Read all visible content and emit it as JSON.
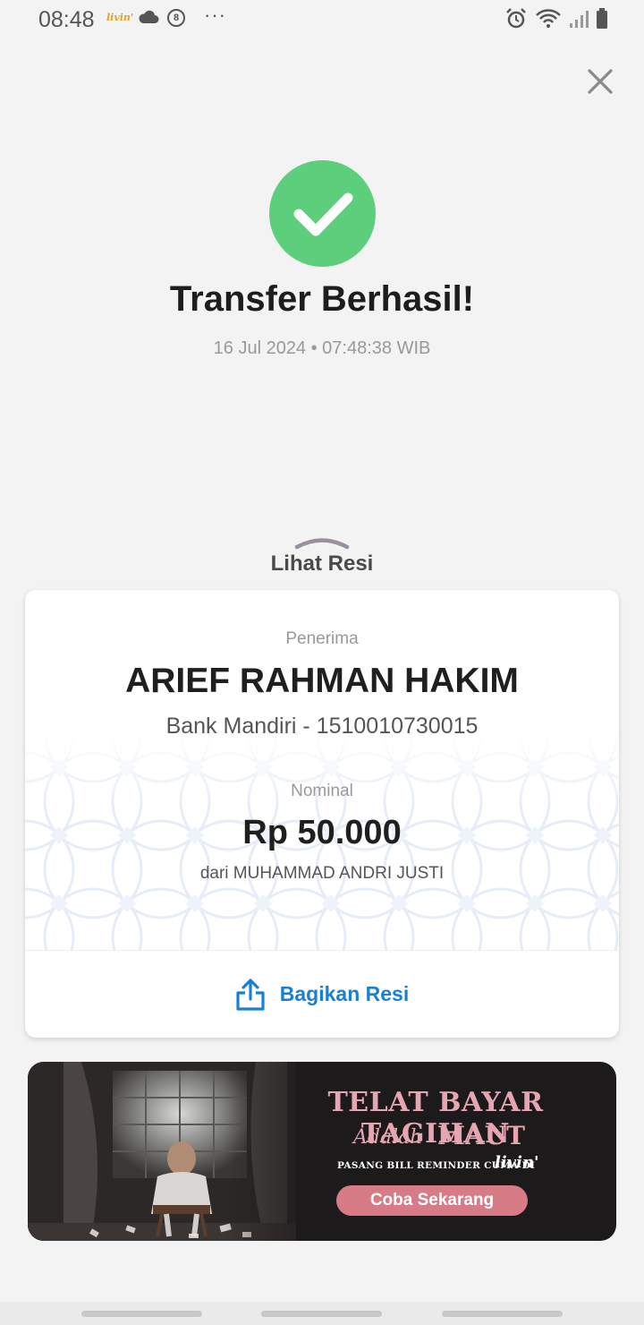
{
  "status_bar": {
    "time": "08:48",
    "brand": "livin'",
    "badge": "8",
    "more": "···",
    "icons": [
      "alarm-icon",
      "wifi-icon",
      "signal-icon",
      "battery-icon"
    ]
  },
  "result": {
    "title": "Transfer Berhasil!",
    "datetime": "16 Jul 2024 • 07:48:38 WIB",
    "status_color": "#5dcf7c"
  },
  "receipt": {
    "toggle_label": "Lihat Resi",
    "recipient_label": "Penerima",
    "recipient_name": "ARIEF RAHMAN HAKIM",
    "recipient_account": "Bank Mandiri - 1510010730015",
    "amount_label": "Nominal",
    "amount": "Rp 50.000",
    "sender": "dari MUHAMMAD ANDRI JUSTI",
    "share_label": "Bagikan Resi",
    "accent_color": "#1a7fd4"
  },
  "banner": {
    "headline": "TELAT BAYAR TAGIHAN",
    "script_word": "Adalah",
    "headline2": "MAUT",
    "subline": "PASANG BILL REMINDER CUMA DI",
    "brand": "livin'",
    "cta": "Coba Sekarang",
    "accent_color": "#d77b86"
  }
}
